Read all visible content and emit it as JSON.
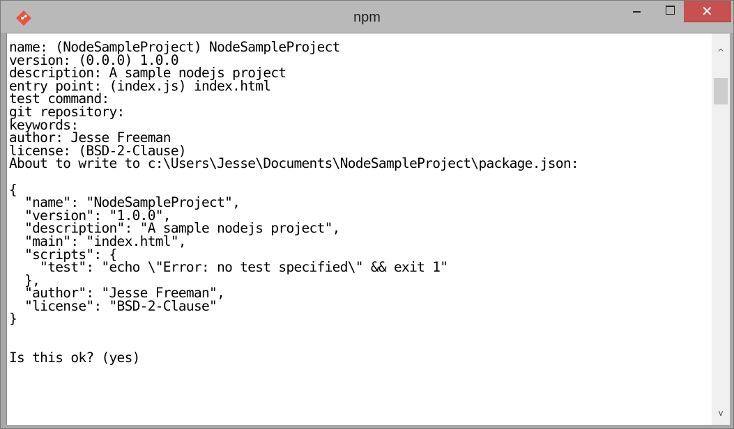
{
  "window": {
    "title": "npm",
    "app_icon": "git-diamond-icon",
    "accent_color": "#c75050",
    "controls": {
      "minimize": "minimize-icon",
      "maximize": "maximize-icon",
      "close_glyph": "✕"
    }
  },
  "console": {
    "lines": [
      "name: (NodeSampleProject) NodeSampleProject",
      "version: (0.0.0) 1.0.0",
      "description: A sample nodejs project",
      "entry point: (index.js) index.html",
      "test command:",
      "git repository:",
      "keywords:",
      "author: Jesse Freeman",
      "license: (BSD-2-Clause)",
      "About to write to c:\\Users\\Jesse\\Documents\\NodeSampleProject\\package.json:",
      "",
      "{",
      "  \"name\": \"NodeSampleProject\",",
      "  \"version\": \"1.0.0\",",
      "  \"description\": \"A sample nodejs project\",",
      "  \"main\": \"index.html\",",
      "  \"scripts\": {",
      "    \"test\": \"echo \\\"Error: no test specified\\\" && exit 1\"",
      "  },",
      "  \"author\": \"Jesse Freeman\",",
      "  \"license\": \"BSD-2-Clause\"",
      "}",
      "",
      "",
      "Is this ok? (yes)"
    ]
  },
  "scrollbar": {
    "up_glyph": "^",
    "down_glyph": "v"
  }
}
